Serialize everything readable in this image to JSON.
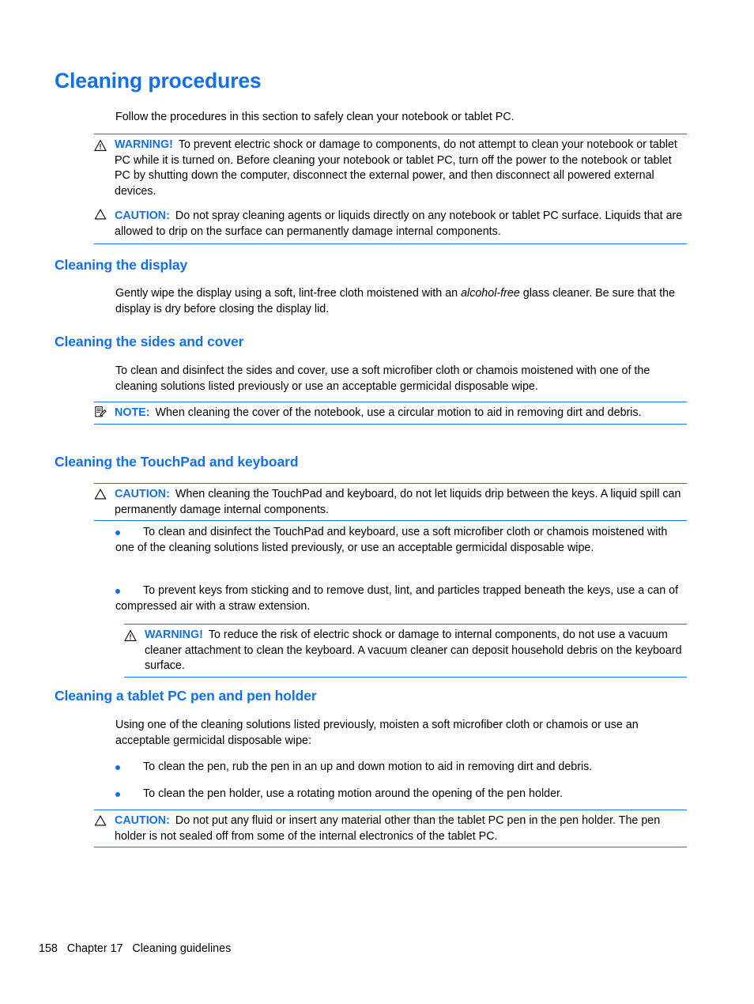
{
  "page": {
    "title": "Cleaning procedures",
    "intro": "Follow the procedures in this section to safely clean your notebook or tablet PC.",
    "accent_color": "#1270e8",
    "text_color": "#000000",
    "background_color": "#ffffff"
  },
  "admonitions": {
    "warning1": {
      "icon": "warning-triangle-icon",
      "label": "WARNING!",
      "text": "To prevent electric shock or damage to components, do not attempt to clean your notebook or tablet PC while it is turned on. Before cleaning your notebook or tablet PC, turn off the power to the notebook or tablet PC by shutting down the computer, disconnect the external power, and then disconnect all powered external devices."
    },
    "caution1": {
      "icon": "caution-triangle-icon",
      "label": "CAUTION:",
      "text": "Do not spray cleaning agents or liquids directly on any notebook or tablet PC surface. Liquids that are allowed to drip on the surface can permanently damage internal components."
    },
    "note1": {
      "icon": "note-pencil-icon",
      "label": "NOTE:",
      "text": "When cleaning the cover of the notebook, use a circular motion to aid in removing dirt and debris."
    },
    "caution2": {
      "icon": "caution-triangle-icon",
      "label": "CAUTION:",
      "text": "When cleaning the TouchPad and keyboard, do not let liquids drip between the keys. A liquid spill can permanently damage internal components."
    },
    "warning2": {
      "icon": "warning-triangle-icon",
      "label": "WARNING!",
      "text": "To reduce the risk of electric shock or damage to internal components, do not use a vacuum cleaner attachment to clean the keyboard. A vacuum cleaner can deposit household debris on the keyboard surface."
    },
    "caution3": {
      "icon": "caution-triangle-icon",
      "label": "CAUTION:",
      "text": "Do not put any fluid or insert any material other than the tablet PC pen in the pen holder. The pen holder is not sealed off from some of the internal electronics of the tablet PC."
    }
  },
  "sections": {
    "display": {
      "heading": "Cleaning the display",
      "para_before": "Gently wipe the display using a soft, lint-free cloth moistened with an ",
      "para_italic": "alcohol-free",
      "para_after": " glass cleaner. Be sure that the display is dry before closing the display lid."
    },
    "sides": {
      "heading": "Cleaning the sides and cover",
      "para": "To clean and disinfect the sides and cover, use a soft microfiber cloth or chamois moistened with one of the cleaning solutions listed previously or use an acceptable germicidal disposable wipe."
    },
    "touchpad": {
      "heading": "Cleaning the TouchPad and keyboard",
      "bullets": [
        "To clean and disinfect the TouchPad and keyboard, use a soft microfiber cloth or chamois moistened with one of the cleaning solutions listed previously, or use an acceptable germicidal disposable wipe.",
        "To prevent keys from sticking and to remove dust, lint, and particles trapped beneath the keys, use a can of compressed air with a straw extension."
      ]
    },
    "pen": {
      "heading": "Cleaning a tablet PC pen and pen holder",
      "para": "Using one of the cleaning solutions listed previously, moisten a soft microfiber cloth or chamois or use an acceptable germicidal disposable wipe:",
      "bullets": [
        "To clean the pen, rub the pen in an up and down motion to aid in removing dirt and debris.",
        "To clean the pen holder, use a rotating motion around the opening of the pen holder."
      ]
    }
  },
  "footer": {
    "page_number": "158",
    "chapter": "Chapter 17",
    "chapter_title": "Cleaning guidelines",
    "full": "158   Chapter 17   Cleaning guidelines"
  }
}
